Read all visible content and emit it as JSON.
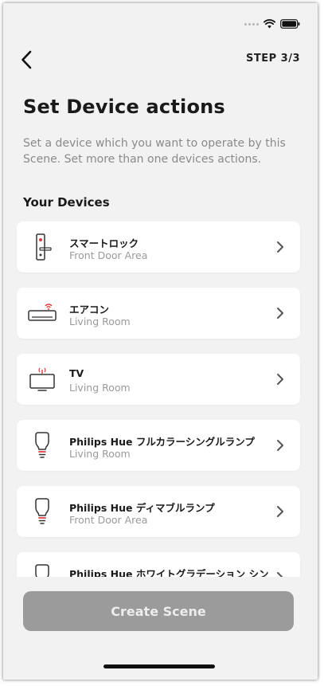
{
  "status_bar": {
    "icons": [
      "signal-dots-icon",
      "wifi-icon",
      "battery-icon"
    ]
  },
  "header": {
    "back_icon": "chevron-left-icon",
    "step": "STEP 3/3"
  },
  "title": "Set Device actions",
  "description": "Set a device which you want to operate by this Scene. Set more than one devices actions.",
  "section_title": "Your Devices",
  "devices": [
    {
      "name": "スマートロック",
      "location": "Front Door Area",
      "icon": "smart-lock-icon"
    },
    {
      "name": "エアコン",
      "location": "Living Room",
      "icon": "air-conditioner-icon"
    },
    {
      "name": "TV",
      "location": "Living Room",
      "icon": "tv-icon"
    },
    {
      "name": "Philips Hue フルカラーシングルランプ",
      "location": "Living Room",
      "icon": "light-bulb-icon"
    },
    {
      "name": "Philips Hue ディマブルランプ",
      "location": "Front Door Area",
      "icon": "light-bulb-icon"
    },
    {
      "name": "Philips Hue ホワイトグラデーション シン",
      "location": "",
      "icon": "light-bulb-icon"
    }
  ],
  "create_button": "Create Scene",
  "colors": {
    "background": "#f2f2f2",
    "card": "#ffffff",
    "accent_red": "#e23b3b",
    "button_disabled": "#9b9b9b"
  }
}
